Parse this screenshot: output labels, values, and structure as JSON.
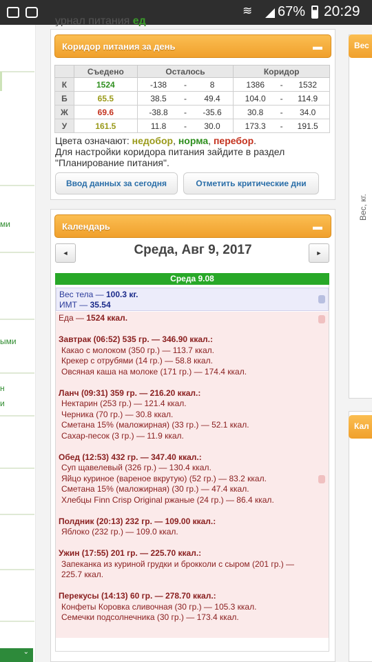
{
  "status_bar": {
    "battery": "67%",
    "time": "20:29"
  },
  "top_truncated_text": "урнал питания           ",
  "top_truncated_green": "ед",
  "corridor_panel": {
    "title": "Коридор питания за день",
    "minimize": "▬",
    "columns": [
      "Съедено",
      "Осталось",
      "Коридор"
    ],
    "rows": [
      {
        "label": "К",
        "eaten": "1524",
        "status": "norma",
        "rem_from": "-138",
        "rem_to": "8",
        "cor_from": "1386",
        "cor_to": "1532"
      },
      {
        "label": "Б",
        "eaten": "65.5",
        "status": "nedobor",
        "rem_from": "38.5",
        "rem_to": "49.4",
        "cor_from": "104.0",
        "cor_to": "114.9"
      },
      {
        "label": "Ж",
        "eaten": "69.6",
        "status": "perebor",
        "rem_from": "-38.8",
        "rem_to": "-35.6",
        "cor_from": "30.8",
        "cor_to": "34.0"
      },
      {
        "label": "У",
        "eaten": "161.5",
        "status": "nedobor",
        "rem_from": "11.8",
        "rem_to": "30.0",
        "cor_from": "173.3",
        "cor_to": "191.5"
      }
    ],
    "dash": "-",
    "legend_prefix": "Цвета означают: ",
    "legend_under": "недобор",
    "legend_comma1": ", ",
    "legend_norm": "норма",
    "legend_comma2": ", ",
    "legend_over": "перебор",
    "legend_dot": ".",
    "settings_note": "Для настройки коридора питания зайдите в раздел \"Планирование питания\".",
    "btn_input": "Ввод данных за сегодня",
    "btn_critical": "Отметить критические дни",
    "colors": {
      "under": "#9a9a1a",
      "norm": "#2f8f1f",
      "over": "#c4321e",
      "accent": "#f0a02c"
    }
  },
  "calendar_panel": {
    "title": "Календарь",
    "minimize": "▬",
    "prev": "◄",
    "next": "►",
    "date": "Среда, Авг 9, 2017",
    "day_header": "Среда 9.08",
    "weight_label": "Вес тела — ",
    "weight_value": "100.3 кг.",
    "bmi_label": "ИМТ — ",
    "bmi_value": "35.54",
    "food_label": "Еда — ",
    "food_value": "1524 ккал.",
    "meals": [
      {
        "header": "Завтрак (06:52) 535 гр. — 346.90 ккал.:",
        "items": [
          "Какао с молоком (350 гр.) — 113.7 ккал.",
          "Крекер с отрубями (14 гр.) — 58.8 ккал.",
          "Овсяная каша на молоке (171 гр.) — 174.4 ккал."
        ]
      },
      {
        "header": "Ланч (09:31) 359 гр. — 216.20 ккал.:",
        "items": [
          "Нектарин (253 гр.) — 121.4 ккал.",
          "Черника (70 гр.) — 30.8 ккал.",
          "Сметана 15% (маложирная) (33 гр.) — 52.1 ккал.",
          "Сахар-песок (3 гр.) — 11.9 ккал."
        ]
      },
      {
        "header": "Обед (12:53) 432 гр. — 347.40 ккал.:",
        "items": [
          "Суп щавелевый (326 гр.) — 130.4 ккал.",
          "Яйцо куриное (вареное вкрутую) (52 гр.) — 83.2 ккал.",
          "Сметана 15% (маложирная) (30 гр.) — 47.4 ккал.",
          "Хлебцы Finn Crisp Original ржаные (24 гр.) — 86.4 ккал."
        ]
      },
      {
        "header": "Полдник (20:13) 232 гр. — 109.00 ккал.:",
        "items": [
          "Яблоко (232 гр.) — 109.0 ккал."
        ]
      },
      {
        "header": "Ужин (17:55) 201 гр. — 225.70 ккал.:",
        "items": [
          "Запеканка из куриной грудки и брокколи с сыром (201 гр.) —",
          "225.7 ккал."
        ]
      },
      {
        "header": "Перекусы (14:13) 60 гр. — 278.70 ккал.:",
        "items": [
          "Конфеты Коровка сливочная (30 гр.) — 105.3 ккал.",
          "Семечки подсолнечника (30 гр.) — 173.4 ккал."
        ]
      }
    ]
  },
  "right_column": {
    "panel1_title": "Вес",
    "vertical_text": "Вес, кг.",
    "panel2_title": "Кал"
  },
  "left_column": {
    "frag1": "ми",
    "frag2": "ыми",
    "frag3": "н",
    "frag4": "и"
  }
}
